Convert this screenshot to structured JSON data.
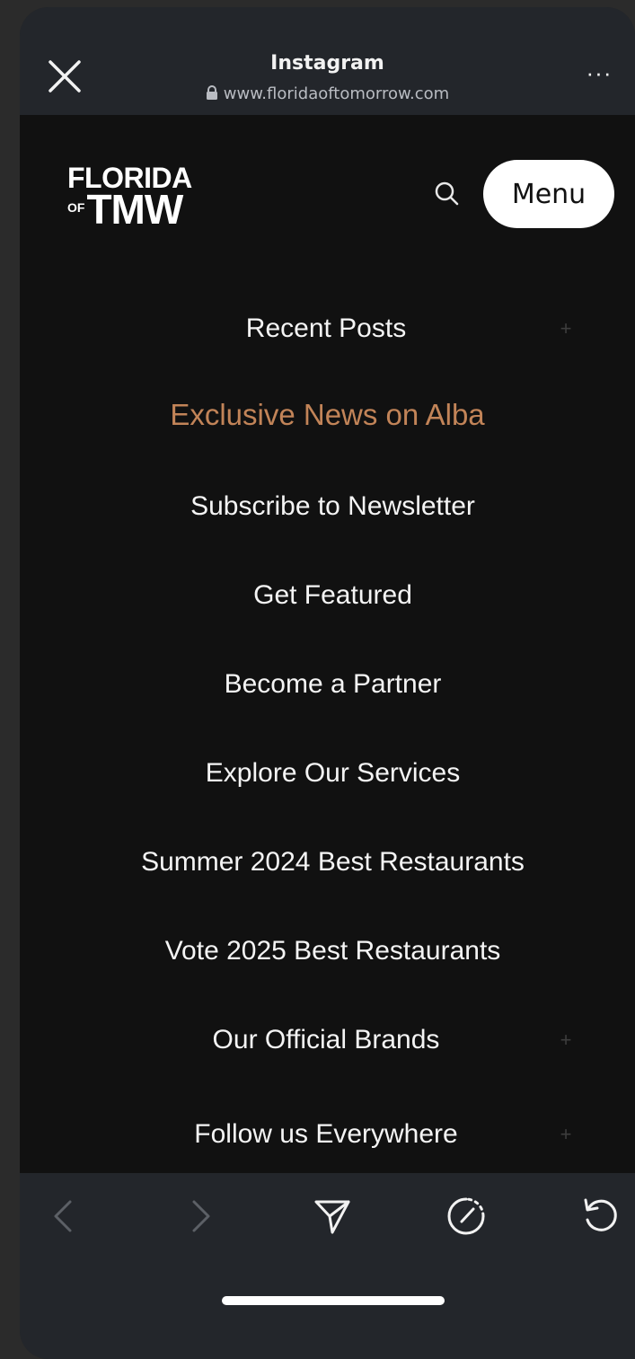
{
  "browser": {
    "title": "Instagram",
    "url": "www.floridaoftomorrow.com",
    "more_label": "···"
  },
  "site": {
    "logo_line1": "FLORIDA",
    "logo_of": "OF",
    "logo_line2": "TMW",
    "menu_label": "Menu"
  },
  "nav": {
    "items": [
      {
        "label": "Recent Posts",
        "expandable": true
      },
      {
        "label": "Exclusive News on Alba",
        "expandable": false,
        "accent": true
      },
      {
        "label": "Subscribe to Newsletter",
        "expandable": false
      },
      {
        "label": "Get Featured",
        "expandable": false
      },
      {
        "label": "Become a Partner",
        "expandable": false
      },
      {
        "label": "Explore Our Services",
        "expandable": false
      },
      {
        "label": "Summer 2024 Best Restaurants",
        "expandable": false
      },
      {
        "label": "Vote 2025 Best Restaurants",
        "expandable": false
      },
      {
        "label": "Our Official Brands",
        "expandable": true
      },
      {
        "label": "Follow us Everywhere",
        "expandable": true
      }
    ],
    "expand_symbol": "+"
  },
  "colors": {
    "accent": "#c28458",
    "background": "#111111",
    "bar": "#23262b"
  },
  "toolbar": {
    "icons": [
      "back-icon",
      "forward-icon",
      "share-icon",
      "browser-icon",
      "reload-icon"
    ]
  }
}
